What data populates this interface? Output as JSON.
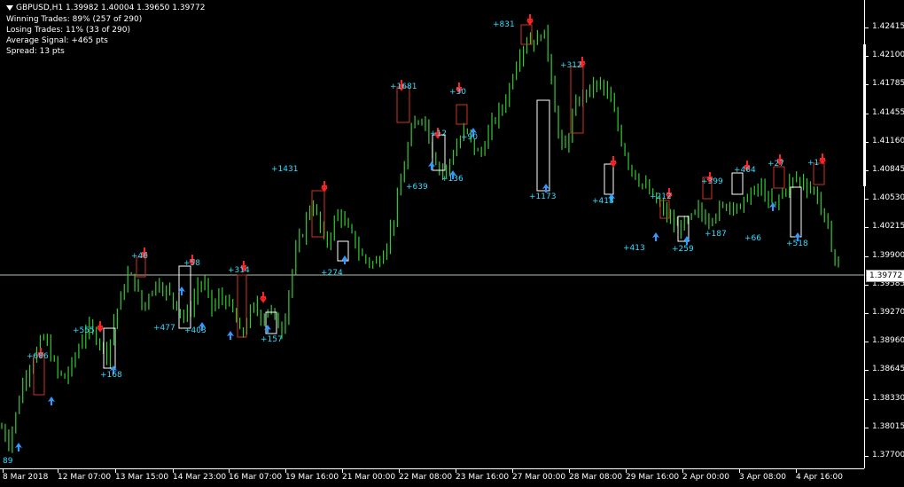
{
  "header": {
    "symbol_line": "GBPUSD,H1  1.39982 1.40004 1.39650 1.39772",
    "winning": "Winning Trades: 89% (257 of 290)",
    "losing": "Losing Trades: 11% (33 of 290)",
    "avg_signal": "Average Signal: +465 pts",
    "spread": "Spread: 13 pts"
  },
  "current_price": "1.39772",
  "price_axis": [
    "1.42415",
    "1.42100",
    "1.41785",
    "1.41455",
    "1.41160",
    "1.40845",
    "1.40530",
    "1.40215",
    "1.39900",
    "1.39585",
    "1.39270",
    "1.38960",
    "1.38645",
    "1.38330",
    "1.38015",
    "1.37700"
  ],
  "time_axis": [
    "8 Mar 2018",
    "12 Mar 07:00",
    "13 Mar 15:00",
    "14 Mar 23:00",
    "16 Mar 07:00",
    "19 Mar 16:00",
    "21 Mar 00:00",
    "22 Mar 08:00",
    "23 Mar 16:00",
    "27 Mar 00:00",
    "28 Mar 08:00",
    "29 Mar 16:00",
    "2 Apr 00:00",
    "3 Apr 08:00",
    "4 Apr 16:00"
  ],
  "signals": [
    "89",
    "+686",
    "+168",
    "+555",
    "+46",
    "+477",
    "+58",
    "+403",
    "+314",
    "+157",
    "+1431",
    "+274",
    "+1681",
    "+639",
    "+12",
    "+136",
    "+30",
    "+90",
    "+831",
    "+1173",
    "+312",
    "+418",
    "+212",
    "+413",
    "+259",
    "+399",
    "+187",
    "+464",
    "+66",
    "+27",
    "+518",
    "+1"
  ],
  "colors": {
    "bull": "#33cc33",
    "sell": "#ff2222",
    "buy": "#3399ff",
    "label": "#33ddff",
    "box_buy": "#ffffff",
    "box_sell": "#cc3322"
  },
  "price_series": [
    1.38,
    1.3785,
    1.3815,
    1.385,
    1.387,
    1.3885,
    1.39,
    1.388,
    1.386,
    1.3855,
    1.387,
    1.389,
    1.391,
    1.3905,
    1.3895,
    1.388,
    1.392,
    1.3945,
    1.397,
    1.396,
    1.393,
    1.395,
    1.396,
    1.3955,
    1.3945,
    1.3935,
    1.392,
    1.3935,
    1.396,
    1.3955,
    1.393,
    1.3945,
    1.394,
    1.3925,
    1.39,
    1.392,
    1.3935,
    1.392,
    1.3935,
    1.3915,
    1.391,
    1.396,
    1.4,
    1.402,
    1.405,
    1.403,
    1.4,
    1.402,
    1.404,
    1.402,
    1.401,
    1.399,
    1.3985,
    1.398,
    1.399,
    1.401,
    1.404,
    1.408,
    1.412,
    1.414,
    1.4145,
    1.411,
    1.409,
    1.408,
    1.41,
    1.4115,
    1.413,
    1.411,
    1.41,
    1.412,
    1.414,
    1.415,
    1.417,
    1.42,
    1.422,
    1.423,
    1.4225,
    1.424,
    1.42,
    1.413,
    1.41,
    1.414,
    1.416,
    1.417,
    1.4175,
    1.418,
    1.417,
    1.415,
    1.412,
    1.4095,
    1.408,
    1.407,
    1.406,
    1.405,
    1.404,
    1.403,
    1.402,
    1.4025,
    1.403,
    1.404,
    1.403,
    1.4035,
    1.404,
    1.4045,
    1.405,
    1.404,
    1.4055,
    1.406,
    1.4065,
    1.405,
    1.4045,
    1.406,
    1.407,
    1.4075,
    1.407,
    1.4065,
    1.4055,
    1.403,
    1.4,
    1.3977
  ]
}
